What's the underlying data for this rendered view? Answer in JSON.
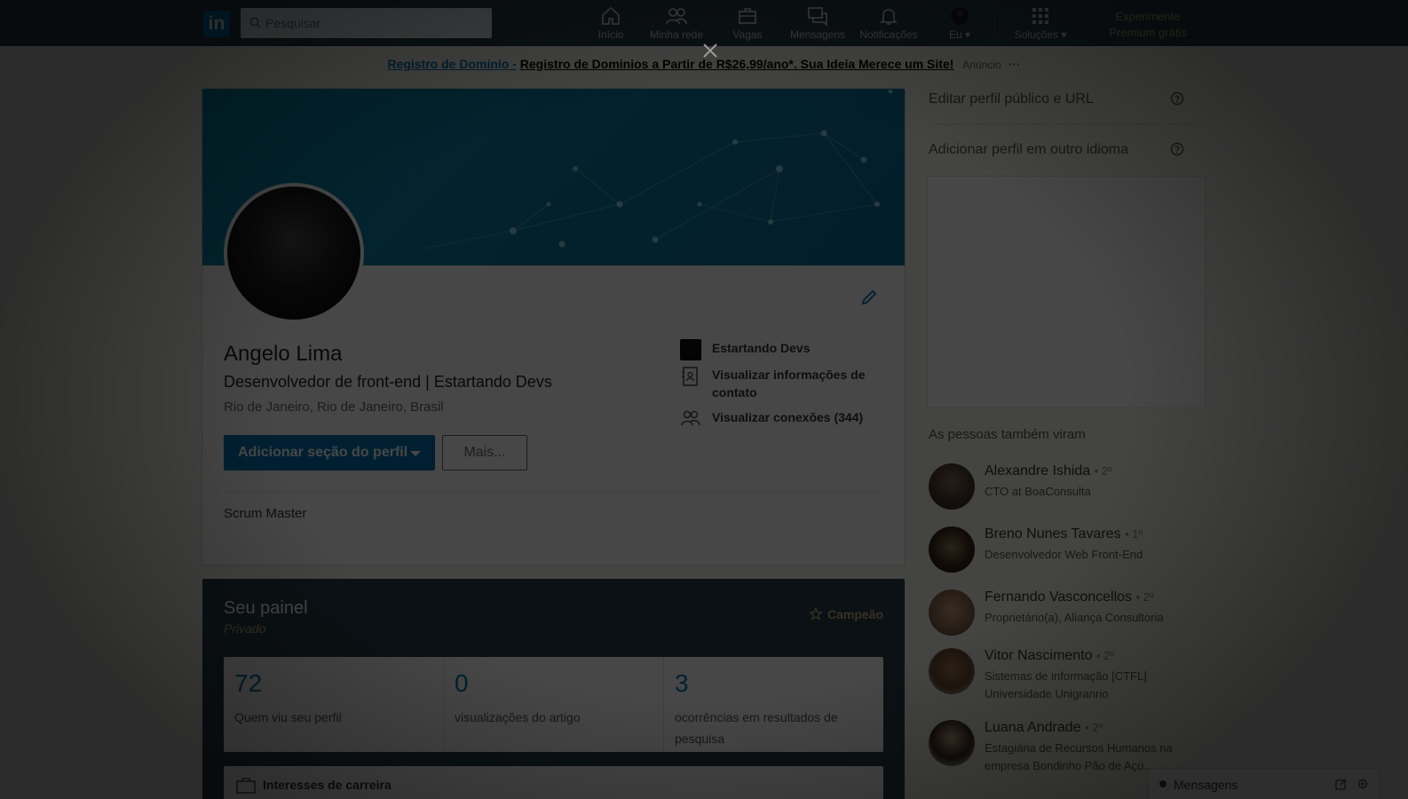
{
  "nav": {
    "logo": "in",
    "search_placeholder": "Pesquisar",
    "items": [
      {
        "label": "Início",
        "icon": "home-icon"
      },
      {
        "label": "Minha rede",
        "icon": "network-icon"
      },
      {
        "label": "Vagas",
        "icon": "briefcase-icon"
      },
      {
        "label": "Mensagens",
        "icon": "messages-icon"
      },
      {
        "label": "Notificações",
        "icon": "bell-icon"
      },
      {
        "label": "Eu",
        "icon": "avatar"
      },
      {
        "label": "Soluções",
        "icon": "grid-icon"
      }
    ],
    "premium_line1": "Experimente",
    "premium_line2": "Premium grátis"
  },
  "ad": {
    "link": "Registro de Domínio -",
    "text": "Registro de Dominios a Partir de R$26,99/ano*. Sua Ideia Merece um Site!",
    "tag": "Anúncio",
    "more": "···"
  },
  "profile": {
    "name": "Angelo Lima",
    "headline": "Desenvolvedor de front-end | Estartando Devs",
    "location": "Rio de Janeiro, Rio de Janeiro, Brasil",
    "add_section_label": "Adicionar seção do perfil",
    "more_label": "Mais...",
    "company": "Estartando Devs",
    "contact_info": "Visualizar informações de contato",
    "connections": "Visualizar conexões (344)",
    "summary": "Scrum Master"
  },
  "dashboard": {
    "title": "Seu painel",
    "subtitle": "Privado",
    "badge": "Campeão",
    "stats": [
      {
        "value": "72",
        "label": "Quem viu seu perfil"
      },
      {
        "value": "0",
        "label": "visualizações do artigo"
      },
      {
        "value": "3",
        "label": "ocorrências em resultados de pesquisa"
      }
    ],
    "career_label": "Interesses de carreira"
  },
  "rail": {
    "edit_public_profile": "Editar perfil público e URL",
    "add_language_profile": "Adicionar perfil em outro idioma",
    "people_title": "As pessoas também viram",
    "people": [
      {
        "name": "Alexandre Ishida",
        "degree": "• 2º",
        "title": "CTO at BoaConsulta"
      },
      {
        "name": "Breno Nunes Tavares",
        "degree": "• 1º",
        "title": "Desenvolvedor Web Front-End"
      },
      {
        "name": "Fernando Vasconcellos",
        "degree": "• 2º",
        "title": "Proprietário(a), Aliança Consultoria"
      },
      {
        "name": "Vitor Nascimento",
        "degree": "• 2º",
        "title": "Sistemas de informação [CTFL] Universidade Unigranrio"
      },
      {
        "name": "Luana Andrade",
        "degree": "• 2º",
        "title": "Estagiária de Recursos Humanos na empresa Bondinho Pão de Açú..."
      }
    ]
  },
  "messaging": {
    "label": "Mensagens"
  },
  "colors": {
    "brand": "#0073b1",
    "nav_bg": "#283e4a",
    "premium_gold": "#c9b27a"
  }
}
